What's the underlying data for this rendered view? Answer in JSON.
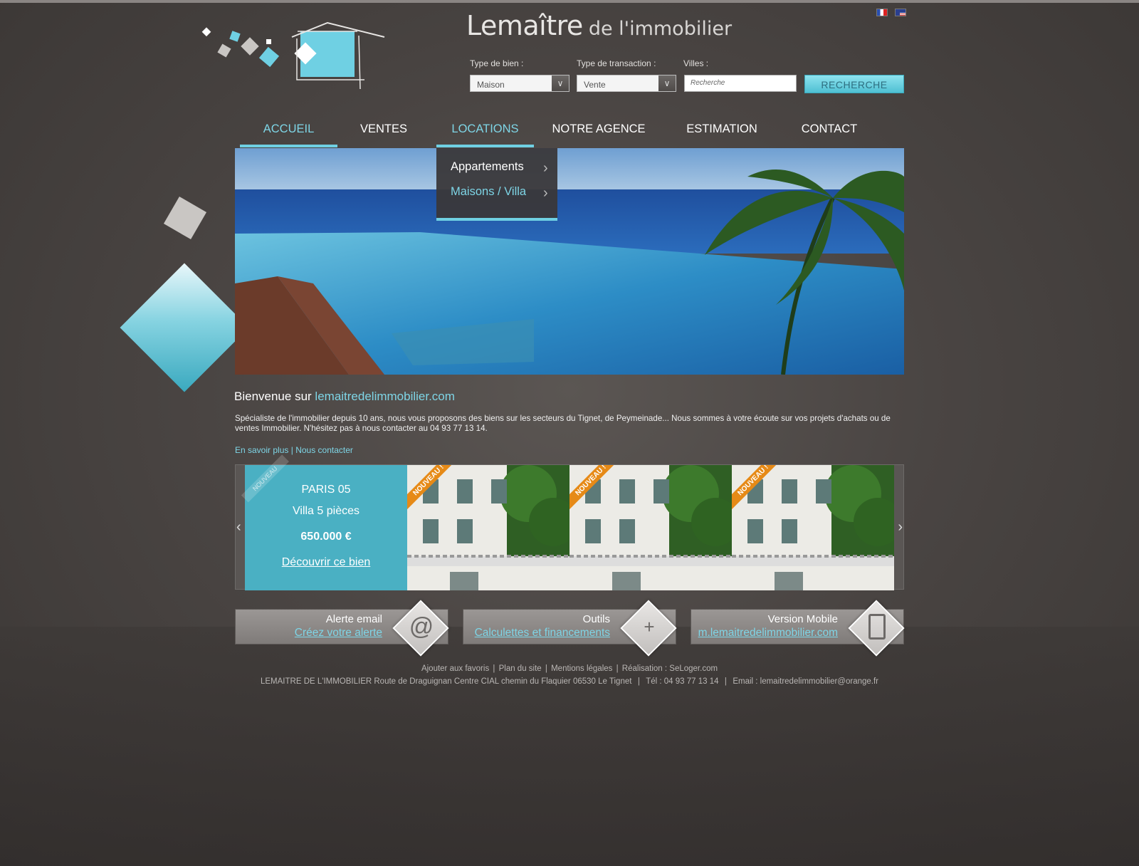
{
  "brand": {
    "name_main": "Lemaître",
    "name_sub": "de l'immobilier"
  },
  "languages": [
    {
      "icon": "french-flag-icon"
    },
    {
      "icon": "english-flag-icon"
    }
  ],
  "search": {
    "type_label": "Type de bien :",
    "type_value": "Maison",
    "transaction_label": "Type de transaction :",
    "transaction_value": "Vente",
    "city_label": "Villes :",
    "city_placeholder": "Recherche",
    "button_label": "RECHERCHE"
  },
  "nav": {
    "items": [
      {
        "label": "ACCUEIL",
        "state": "active"
      },
      {
        "label": "VENTES"
      },
      {
        "label": "LOCATIONS",
        "state": "hover"
      },
      {
        "label": "NOTRE AGENCE"
      },
      {
        "label": "ESTIMATION"
      },
      {
        "label": "CONTACT"
      }
    ],
    "dropdown": [
      {
        "label": "Appartements"
      },
      {
        "label": "Maisons / Villa",
        "state": "hover"
      }
    ]
  },
  "welcome": {
    "prefix": "Bienvenue sur",
    "site": "lemaitredelimmobilier.com",
    "description": "Spécialiste de l'immobilier depuis 10 ans, nous vous proposons des biens sur les secteurs du Tignet, de Peymeinade... Nous sommes à votre écoute sur vos projets d'achats ou de ventes Immobilier. N'hésitez pas à nous contacter au 04 93 77 13 14.",
    "link_more": "En savoir plus",
    "link_separator": "|",
    "link_contact": "Nous contacter"
  },
  "carousel": {
    "feature": {
      "badge": "NOUVEAU",
      "city": "PARIS 05",
      "type": "Villa 5 pièces",
      "price": "650.000 €",
      "cta": "Découvrir ce bien"
    },
    "thumbs": [
      {
        "badge": "NOUVEAU !"
      },
      {
        "badge": "NOUVEAU !"
      },
      {
        "badge": "NOUVEAU !"
      }
    ]
  },
  "boxes": [
    {
      "title": "Alerte email",
      "link": "Créez votre alerte",
      "icon": "at-sign-icon"
    },
    {
      "title": "Outils",
      "link": "Calculettes et financements",
      "icon": "plus-icon"
    },
    {
      "title": "Version Mobile",
      "link": "m.lemaitredelimmobilier.com",
      "icon": "smartphone-icon"
    }
  ],
  "footer": {
    "links": [
      "Ajouter aux favoris",
      "Plan du site",
      "Mentions légales",
      "Réalisation : SeLoger.com"
    ],
    "address": "LEMAITRE DE L'IMMOBILIER Route de Draguignan Centre CIAL chemin du Flaquier 06530 Le Tignet",
    "phone": "Tél : 04 93 77 13 14",
    "email": "Email : lemaitredelimmobilier@orange.fr"
  },
  "colors": {
    "accent": "#6fd0e3",
    "feature_bg": "#4ab0c3",
    "background": "#4a4543"
  }
}
